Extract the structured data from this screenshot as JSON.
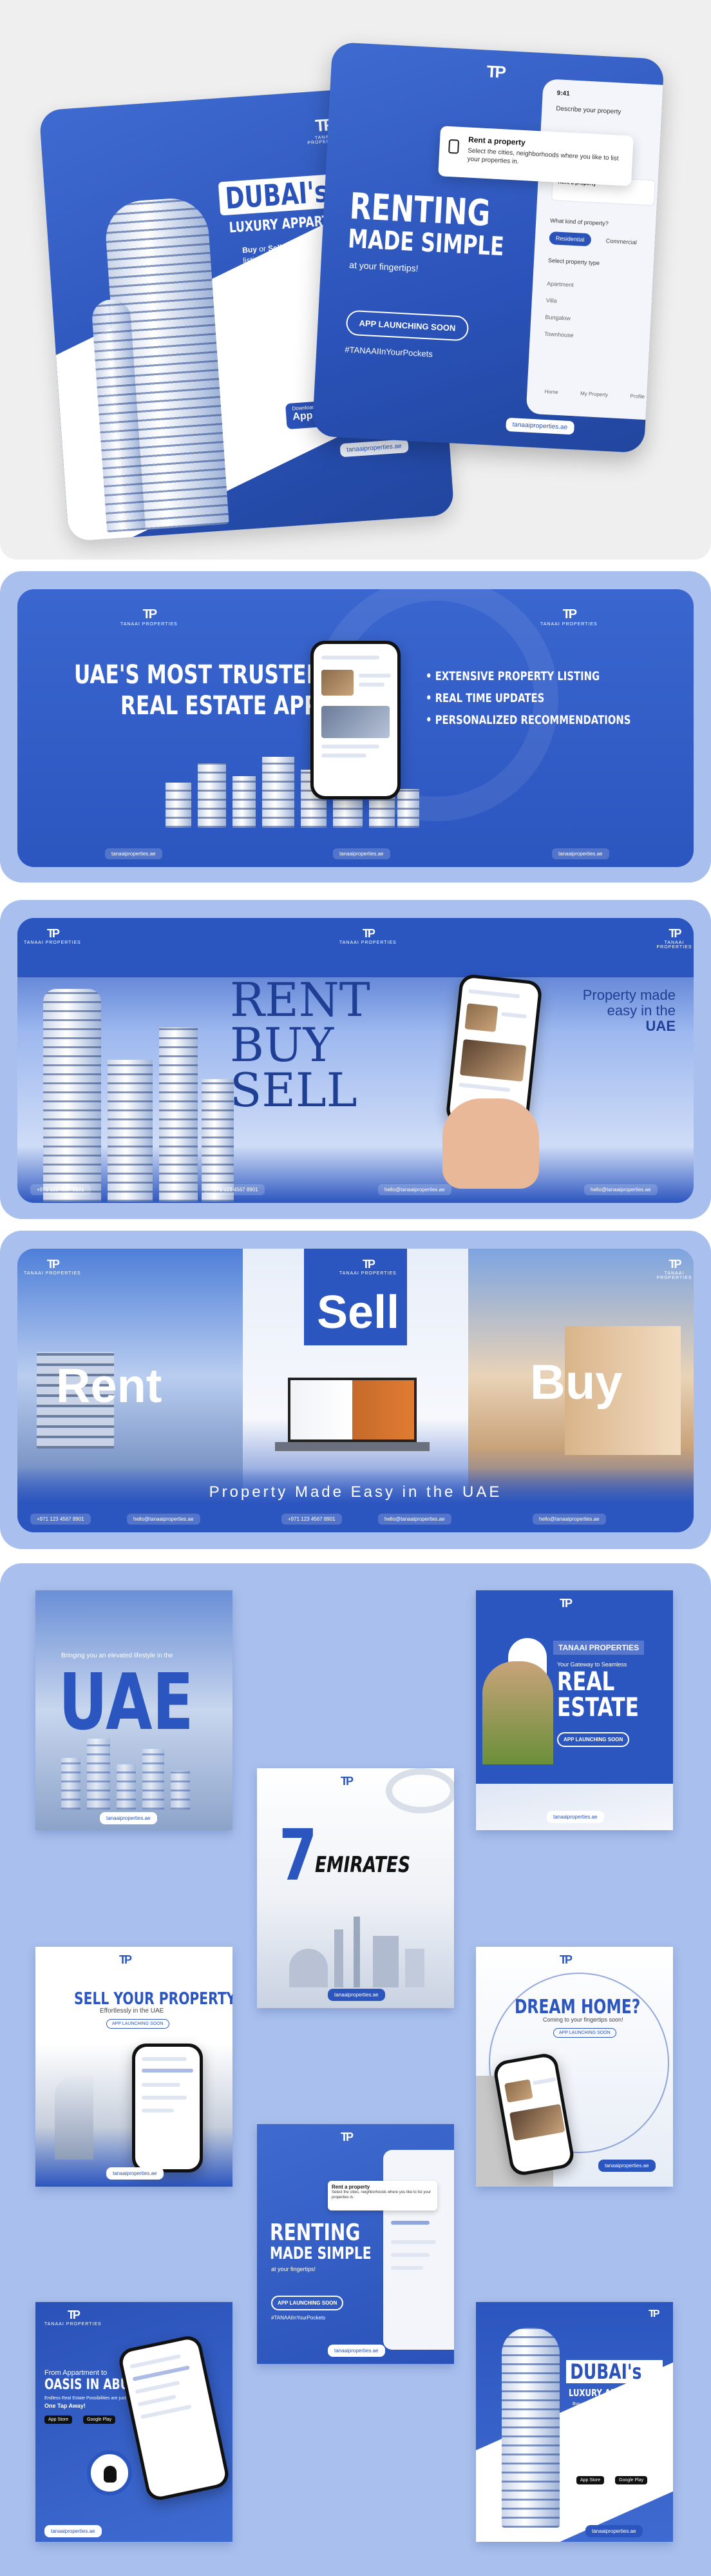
{
  "brand": {
    "logo_mark": "TP",
    "name": "TANAAI PROPERTIES",
    "website": "tanaaiproperties.ae",
    "phone": "+971 123 4567 8901",
    "email": "hello@tanaaiproperties.ae",
    "primary_color": "#2c56bf",
    "light_color": "#a9c0ee"
  },
  "section1": {
    "dubai_card": {
      "title": "DUBAI's",
      "subtitle": "LUXURY APPARTMENT",
      "body_buy": "Buy",
      "body_or": " or ",
      "body_sell": "Sell",
      "body_rest": " with ease with our extensive listings",
      "store_badge_small": "Download on the",
      "store_badge": "App Store"
    },
    "renting_card": {
      "title_1": "RENTING",
      "title_2": "MADE SIMPLE",
      "tagline": "at your fingertips!",
      "cta": "APP LAUNCHING SOON",
      "hashtag": "#TANAAIInYourPockets",
      "popup_title": "Rent a property",
      "popup_body": "Select the cities, neighborhoods where you like to list your properties in.",
      "phone_header": "Describe your property",
      "phone_q": "What kind of property?",
      "phone_tab_1": "Residential",
      "phone_tab_2": "Commercial",
      "phone_q2": "Select property type",
      "phone_options": [
        "Apartment",
        "Villa",
        "Bungalow",
        "Townhouse"
      ],
      "phone_nav": [
        "Home",
        "My Property",
        "Profile"
      ]
    }
  },
  "section2": {
    "headline_1": "UAE'S MOST TRUSTED",
    "headline_2": "REAL ESTATE APP",
    "bullets": [
      "EXTENSIVE PROPERTY LISTING",
      "REAL TIME UPDATES",
      "PERSONALIZED RECOMMENDATIONS"
    ]
  },
  "section3": {
    "words": [
      "RENT",
      "BUY",
      "SELL"
    ],
    "tag_1": "Property made",
    "tag_2": "easy in the",
    "tag_3": "UAE"
  },
  "section4": {
    "panels": [
      "Rent",
      "Sell",
      "Buy"
    ],
    "tagline": "Property Made Easy in the UAE"
  },
  "section5": {
    "uae_post": {
      "note": "Bringing you an elevated lifestyle in the",
      "word": "UAE"
    },
    "gateway_post": {
      "brand": "TANAAI PROPERTIES",
      "line": "Your Gateway to Seamless",
      "title_1": "REAL",
      "title_2": "ESTATE",
      "cta": "APP LAUNCHING SOON"
    },
    "emirates_post": {
      "number": "7",
      "word": "EMIRATES"
    },
    "sell_post": {
      "title": "SELL YOUR PROPERTY",
      "sub": "Effortlessly in the UAE",
      "cta": "APP LAUNCHING SOON"
    },
    "dream_post": {
      "title": "DREAM HOME?",
      "sub": "Coming to your fingertips soon!",
      "cta": "APP LAUNCHING SOON"
    },
    "renting_post": {
      "title_1": "RENTING",
      "title_2": "MADE SIMPLE",
      "tagline": "at your fingertips!",
      "cta": "APP LAUNCHING SOON",
      "hashtag": "#TANAAIInYourPockets",
      "popup_title": "Rent a property",
      "popup_body": "Select the cities, neighborhoods where you like to list your properties in."
    },
    "oasis_post": {
      "line_1": "From Appartment to",
      "line_2": "OASIS IN ABU DHABI",
      "line_3": "Endless Real Estate Possibilities are just",
      "line_4": "One Tap Away!",
      "store_1": "App Store",
      "store_2": "Google Play"
    },
    "dubai_post": {
      "title": "DUBAI's",
      "subtitle": "LUXURY APPARTMENT",
      "body": "Buy or Sell with ease with our extensive listings",
      "store_1": "App Store",
      "store_2": "Google Play"
    }
  }
}
